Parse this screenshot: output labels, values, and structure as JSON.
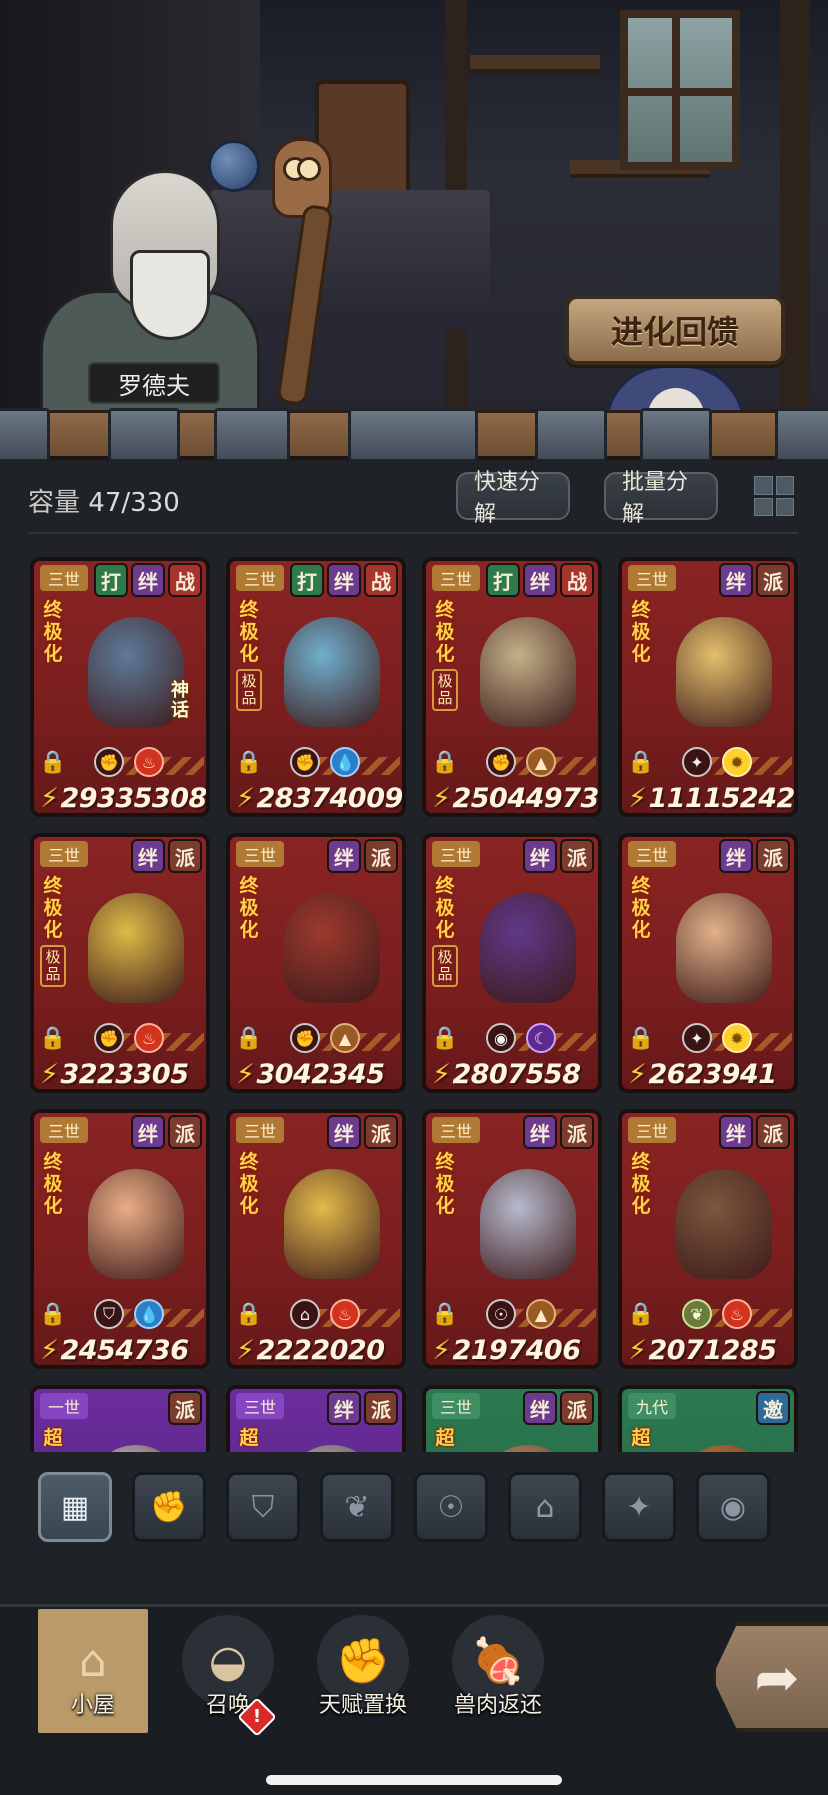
{
  "scene": {
    "npc_name": "罗德夫",
    "evolve_feedback_label": "进化回馈"
  },
  "inventory": {
    "capacity_label": "容量",
    "capacity_value": "47/330",
    "quick_decompose_label": "快速分解",
    "batch_decompose_label": "批量分解"
  },
  "cards": [
    {
      "era": "三世",
      "tags": [
        "打",
        "绊",
        "战"
      ],
      "title": "终极化",
      "grade": "",
      "mythic": "神话",
      "icons": [
        "fist-icon",
        "fire-icon"
      ],
      "cp": "29335308"
    },
    {
      "era": "三世",
      "tags": [
        "打",
        "绊",
        "战"
      ],
      "title": "终极化",
      "grade": "极品",
      "mythic": "",
      "icons": [
        "fist-icon",
        "water-icon"
      ],
      "cp": "28374009"
    },
    {
      "era": "三世",
      "tags": [
        "打",
        "绊",
        "战"
      ],
      "title": "终极化",
      "grade": "极品",
      "mythic": "",
      "icons": [
        "fist-icon",
        "earth-icon"
      ],
      "cp": "25044973"
    },
    {
      "era": "三世",
      "tags": [
        "绊",
        "派"
      ],
      "title": "终极化",
      "grade": "",
      "mythic": "",
      "icons": [
        "compass-icon",
        "light-icon"
      ],
      "cp": "11115242"
    },
    {
      "era": "三世",
      "tags": [
        "绊",
        "派"
      ],
      "title": "终极化",
      "grade": "极品",
      "mythic": "",
      "icons": [
        "fist-icon",
        "fire-icon"
      ],
      "cp": "3223305"
    },
    {
      "era": "三世",
      "tags": [
        "绊",
        "派"
      ],
      "title": "终极化",
      "grade": "",
      "mythic": "",
      "icons": [
        "fist-icon",
        "earth-icon"
      ],
      "cp": "3042345"
    },
    {
      "era": "三世",
      "tags": [
        "绊",
        "派"
      ],
      "title": "终极化",
      "grade": "极品",
      "mythic": "",
      "icons": [
        "eye-icon",
        "moon-icon"
      ],
      "cp": "2807558"
    },
    {
      "era": "三世",
      "tags": [
        "绊",
        "派"
      ],
      "title": "终极化",
      "grade": "",
      "mythic": "",
      "icons": [
        "compass-icon",
        "light-icon"
      ],
      "cp": "2623941"
    },
    {
      "era": "三世",
      "tags": [
        "绊",
        "派"
      ],
      "title": "终极化",
      "grade": "",
      "mythic": "",
      "icons": [
        "shield-icon",
        "water-icon"
      ],
      "cp": "2454736"
    },
    {
      "era": "三世",
      "tags": [
        "绊",
        "派"
      ],
      "title": "终极化",
      "grade": "",
      "mythic": "",
      "icons": [
        "tower-icon",
        "fire-icon"
      ],
      "cp": "2222020"
    },
    {
      "era": "三世",
      "tags": [
        "绊",
        "派"
      ],
      "title": "终极化",
      "grade": "",
      "mythic": "",
      "icons": [
        "alien-icon",
        "earth-icon"
      ],
      "cp": "2197406"
    },
    {
      "era": "三世",
      "tags": [
        "绊",
        "派"
      ],
      "title": "终极化",
      "grade": "",
      "mythic": "",
      "icons": [
        "plant-icon",
        "fire-icon"
      ],
      "cp": "2071285"
    },
    {
      "era": "一世",
      "tags": [
        "派"
      ],
      "title": "超",
      "grade": "",
      "mythic": "",
      "icons": [],
      "cp": ""
    },
    {
      "era": "三世",
      "tags": [
        "绊",
        "派"
      ],
      "title": "超",
      "grade": "",
      "mythic": "",
      "icons": [],
      "cp": ""
    },
    {
      "era": "三世",
      "tags": [
        "绊",
        "派"
      ],
      "title": "超",
      "grade": "",
      "mythic": "",
      "icons": [],
      "cp": ""
    },
    {
      "era": "九代",
      "tags": [
        "邀"
      ],
      "title": "超",
      "grade": "",
      "mythic": "",
      "icons": [],
      "cp": ""
    }
  ],
  "filters": [
    "all-icon",
    "fist-icon",
    "shield-icon",
    "plant-icon",
    "alien-icon",
    "tower-icon",
    "compass-icon",
    "eye-icon"
  ],
  "nav": {
    "hut_label": "小屋",
    "summon_label": "召唤",
    "talent_swap_label": "天赋置换",
    "meat_refund_label": "兽肉返还",
    "summon_badge": "!"
  },
  "colors": {
    "card_red": "#7a1e1e",
    "card_purple": "#6b2d9c",
    "card_green": "#2c7a52",
    "accent_gold": "#ffd24a",
    "nav_active": "#b99a68"
  }
}
